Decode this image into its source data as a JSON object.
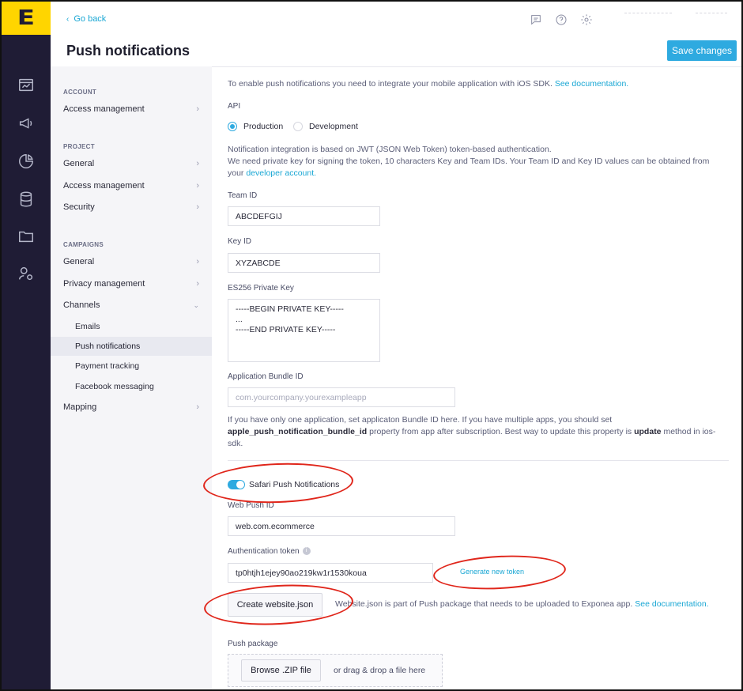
{
  "brand": {
    "logo_glyph": "E",
    "accent": "#ffd500",
    "rail_bg": "#1f1c35",
    "primary": "#2eaae0"
  },
  "rail": {
    "icons": [
      "dashboard-icon",
      "megaphone-icon",
      "pie-chart-icon",
      "database-icon",
      "folder-icon",
      "user-settings-icon"
    ]
  },
  "header": {
    "go_back": "Go back",
    "title": "Push notifications",
    "save_label": "Save changes",
    "icons": [
      "chat-icon",
      "help-icon",
      "gear-icon"
    ]
  },
  "sidebar": {
    "account_label": "ACCOUNT",
    "account_access": "Access management",
    "project_label": "PROJECT",
    "project_general": "General",
    "project_access": "Access management",
    "project_security": "Security",
    "campaigns_label": "CAMPAIGNS",
    "campaigns_general": "General",
    "campaigns_privacy": "Privacy management",
    "campaigns_channels": "Channels",
    "channels": [
      "Emails",
      "Push notifications",
      "Payment tracking",
      "Facebook messaging"
    ],
    "mapping": "Mapping"
  },
  "content": {
    "intro_text": "To enable push notifications you need to integrate your mobile application with iOS SDK. ",
    "intro_link": "See documentation.",
    "api_label": "API",
    "api_options": [
      "Production",
      "Development"
    ],
    "api_selected": "Production",
    "jwt_line1": "Notification integration is based on JWT (JSON Web Token) token-based authentication.",
    "jwt_line2": "We need private key for signing the token, 10 characters Key and Team IDs. Your Team ID and Key ID values can be obtained from",
    "jwt_line3_pre": "your ",
    "jwt_link": "developer account.",
    "team_id_label": "Team ID",
    "team_id_value": "ABCDEFGIJ",
    "key_id_label": "Key ID",
    "key_id_value": "XYZABCDE",
    "private_key_label": "ES256 Private Key",
    "private_key_value": "-----BEGIN PRIVATE KEY-----\n...\n-----END PRIVATE KEY-----",
    "bundle_label": "Application Bundle ID",
    "bundle_placeholder": "com.yourcompany.yourexampleapp",
    "bundle_help_1": "If you have only one application, set applicaton Bundle ID here. If you have multiple apps, you should set",
    "bundle_help_2a": "apple_push_notification_bundle_id",
    "bundle_help_2b": " property from app after subscription. Best way to update this property is ",
    "bundle_help_2c": "update",
    "bundle_help_2d": " method in ios-",
    "bundle_help_3": "sdk.",
    "safari_label": "Safari Push Notifications",
    "safari_enabled": true,
    "web_push_label": "Web Push ID",
    "web_push_value": "web.com.ecommerce",
    "auth_token_label": "Authentication token",
    "auth_token_value": "tp0htjh1ejey90ao219kw1r1530koua",
    "generate_token": "Generate new token",
    "create_json": "Create website.json",
    "website_json_help": "Website.json is part of Push package that needs to be uploaded to Exponea app. ",
    "website_json_link": "See documentation.",
    "push_package_label": "Push package",
    "browse_zip": "Browse .ZIP file",
    "drag_drop": "or drag & drop a file here"
  }
}
